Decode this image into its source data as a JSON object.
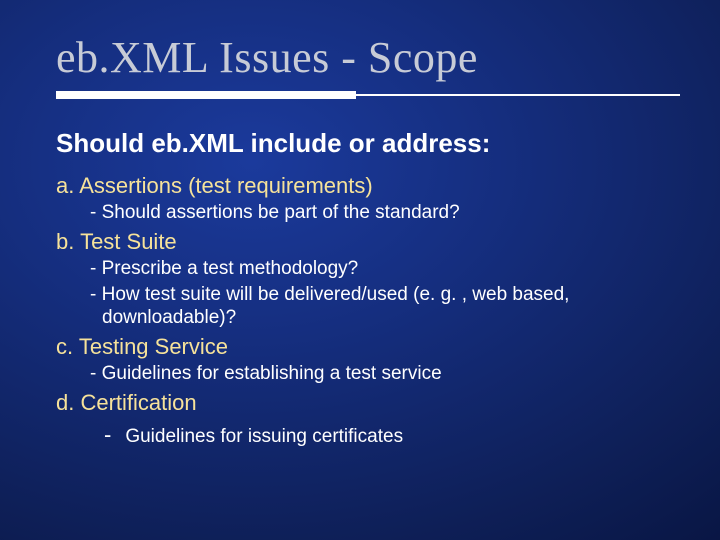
{
  "title": "eb.XML Issues - Scope",
  "heading": "Should eb.XML include or address:",
  "items": {
    "a": {
      "label": "a. Assertions (test requirements)",
      "subs": [
        "- Should assertions be part of the standard?"
      ]
    },
    "b": {
      "label": "b. Test Suite",
      "subs": [
        "- Prescribe a test methodology?",
        "- How test suite will be delivered/used (e. g. , web based, downloadable)?"
      ]
    },
    "c": {
      "label": "c. Testing Service",
      "subs": [
        "- Guidelines for establishing a test service"
      ]
    },
    "d": {
      "label": "d. Certification",
      "sub_dash": {
        "dash": "-",
        "text": "Guidelines for issuing certificates"
      }
    }
  }
}
